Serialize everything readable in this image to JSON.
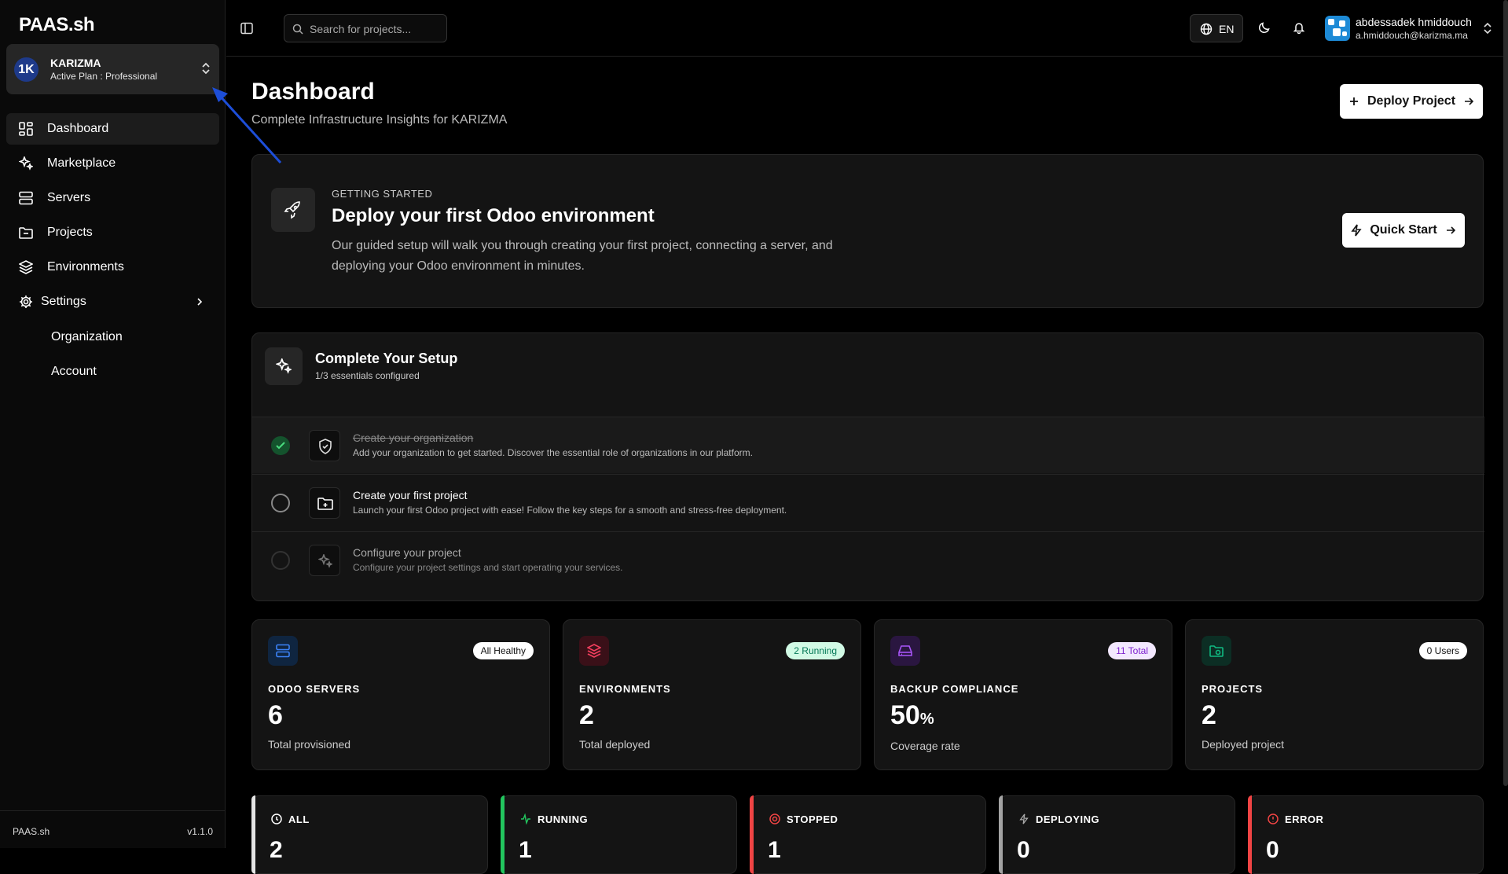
{
  "brand": {
    "logo": "PAAS.sh",
    "footer_name": "PAAS.sh",
    "version": "v1.1.0"
  },
  "org": {
    "initials": "1K",
    "name": "KARIZMA",
    "plan": "Active Plan : Professional"
  },
  "nav": [
    {
      "label": "Dashboard",
      "icon": "dashboard-icon",
      "active": true
    },
    {
      "label": "Marketplace",
      "icon": "marketplace-icon"
    },
    {
      "label": "Servers",
      "icon": "servers-icon"
    },
    {
      "label": "Projects",
      "icon": "projects-icon"
    },
    {
      "label": "Environments",
      "icon": "layers-icon"
    },
    {
      "label": "Settings",
      "icon": "gear-icon"
    }
  ],
  "settings_sub": [
    {
      "label": "Organization"
    },
    {
      "label": "Account"
    }
  ],
  "topbar": {
    "search_placeholder": "Search for projects...",
    "lang": "EN",
    "user_name": "abdessadek hmiddouch",
    "user_email": "a.hmiddouch@karizma.ma"
  },
  "header": {
    "title": "Dashboard",
    "subtitle": "Complete Infrastructure Insights for KARIZMA",
    "deploy_label": "Deploy Project"
  },
  "getting_started": {
    "eyebrow": "GETTING STARTED",
    "title": "Deploy your first Odoo environment",
    "desc": "Our guided setup will walk you through creating your first project, connecting a server, and deploying your Odoo environment in minutes.",
    "cta": "Quick Start"
  },
  "setup": {
    "title": "Complete Your Setup",
    "subtitle": "1/3 essentials configured",
    "steps": [
      {
        "title": "Create your organization",
        "desc": "Add your organization to get started. Discover the essential role of organizations in our platform.",
        "done": true
      },
      {
        "title": "Create your first project",
        "desc": "Launch your first Odoo project with ease! Follow the key steps for a smooth and stress-free deployment.",
        "done": false
      },
      {
        "title": "Configure your project",
        "desc": "Configure your project settings and start operating your services.",
        "done": false
      }
    ]
  },
  "stats": [
    {
      "label": "ODOO SERVERS",
      "value": "6",
      "unit": "",
      "foot": "Total provisioned",
      "badge": "All Healthy",
      "color": "#3b82f6"
    },
    {
      "label": "ENVIRONMENTS",
      "value": "2",
      "unit": "",
      "foot": "Total deployed",
      "badge": "2 Running",
      "color": "#f43f5e"
    },
    {
      "label": "BACKUP COMPLIANCE",
      "value": "50",
      "unit": "%",
      "foot": "Coverage rate",
      "badge": "11 Total",
      "color": "#a855f7"
    },
    {
      "label": "PROJECTS",
      "value": "2",
      "unit": "",
      "foot": "Deployed project",
      "badge": "0 Users",
      "color": "#10b981"
    }
  ],
  "status_cards": [
    {
      "label": "ALL",
      "value": "2",
      "color": "#e5e5e5"
    },
    {
      "label": "RUNNING",
      "value": "1",
      "color": "#22c55e"
    },
    {
      "label": "STOPPED",
      "value": "1",
      "color": "#ef4444"
    },
    {
      "label": "DEPLOYING",
      "value": "0",
      "color": "#a3a3a3"
    },
    {
      "label": "ERROR",
      "value": "0",
      "color": "#ef4444"
    }
  ]
}
